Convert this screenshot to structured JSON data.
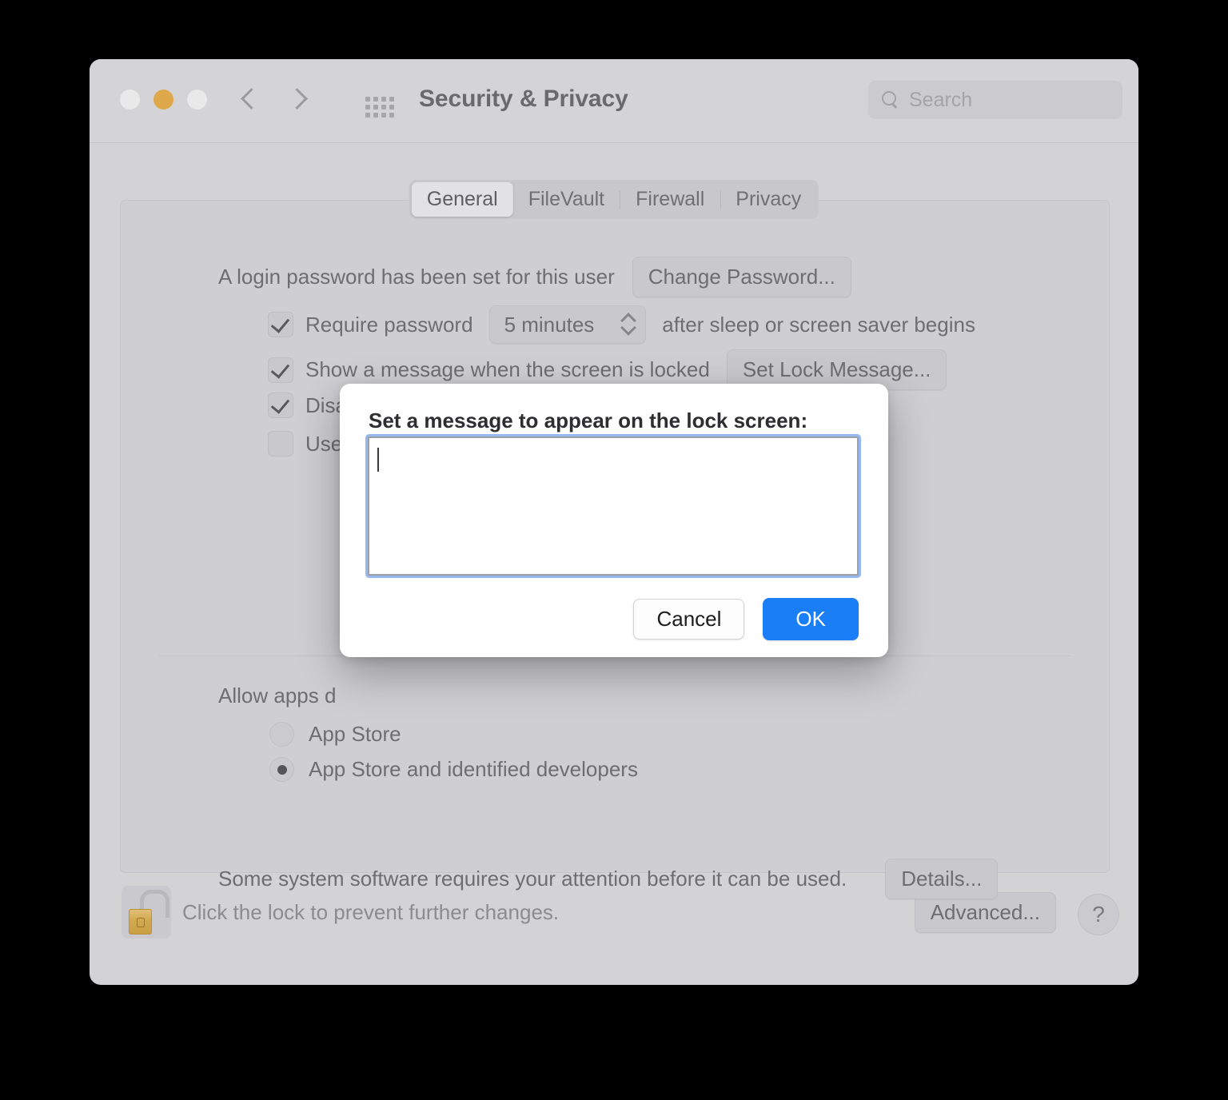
{
  "window": {
    "title": "Security & Privacy",
    "traffic_lights": [
      "close",
      "minimize",
      "zoom"
    ],
    "nav": {
      "back": "back-chevron",
      "forward": "forward-chevron",
      "show_all": "grid-icon"
    },
    "search": {
      "placeholder": "Search",
      "icon": "search-icon"
    }
  },
  "tabs": [
    {
      "label": "General",
      "selected": true
    },
    {
      "label": "FileVault",
      "selected": false
    },
    {
      "label": "Firewall",
      "selected": false
    },
    {
      "label": "Privacy",
      "selected": false
    }
  ],
  "general": {
    "password_status": "A login password has been set for this user",
    "change_password_button": "Change Password...",
    "require_password": {
      "label": "Require password",
      "checked": true,
      "delay_value": "5 minutes",
      "suffix": "after sleep or screen saver begins"
    },
    "show_message": {
      "label": "Show a message when the screen is locked",
      "checked": true,
      "button": "Set Lock Message..."
    },
    "disable_auto_login": {
      "label": "Disab",
      "checked": true
    },
    "apple_watch": {
      "label": "Use y",
      "checked": false
    },
    "allow_apps_label": "Allow apps d",
    "app_sources": [
      {
        "label": "App Store",
        "selected": false
      },
      {
        "label": "App Store and identified developers",
        "selected": true
      }
    ],
    "system_software_notice": "Some system software requires your attention before it can be used.",
    "details_button": "Details..."
  },
  "bottom_bar": {
    "lock_icon": "unlocked-padlock-icon",
    "lock_text": "Click the lock to prevent further changes.",
    "advanced_button": "Advanced...",
    "help_button": "?"
  },
  "sheet": {
    "title": "Set a message to appear on the lock screen:",
    "message_value": "",
    "cancel_button": "Cancel",
    "ok_button": "OK"
  },
  "colors": {
    "accent_blue": "#1a7ef6",
    "focus_ring": "#3f7ee0",
    "window_bg": "#d3d3d6",
    "panel_bg": "#cfcfd3",
    "minimize_yellow": "#dfa94b",
    "lock_gold": "#d2a94f"
  }
}
